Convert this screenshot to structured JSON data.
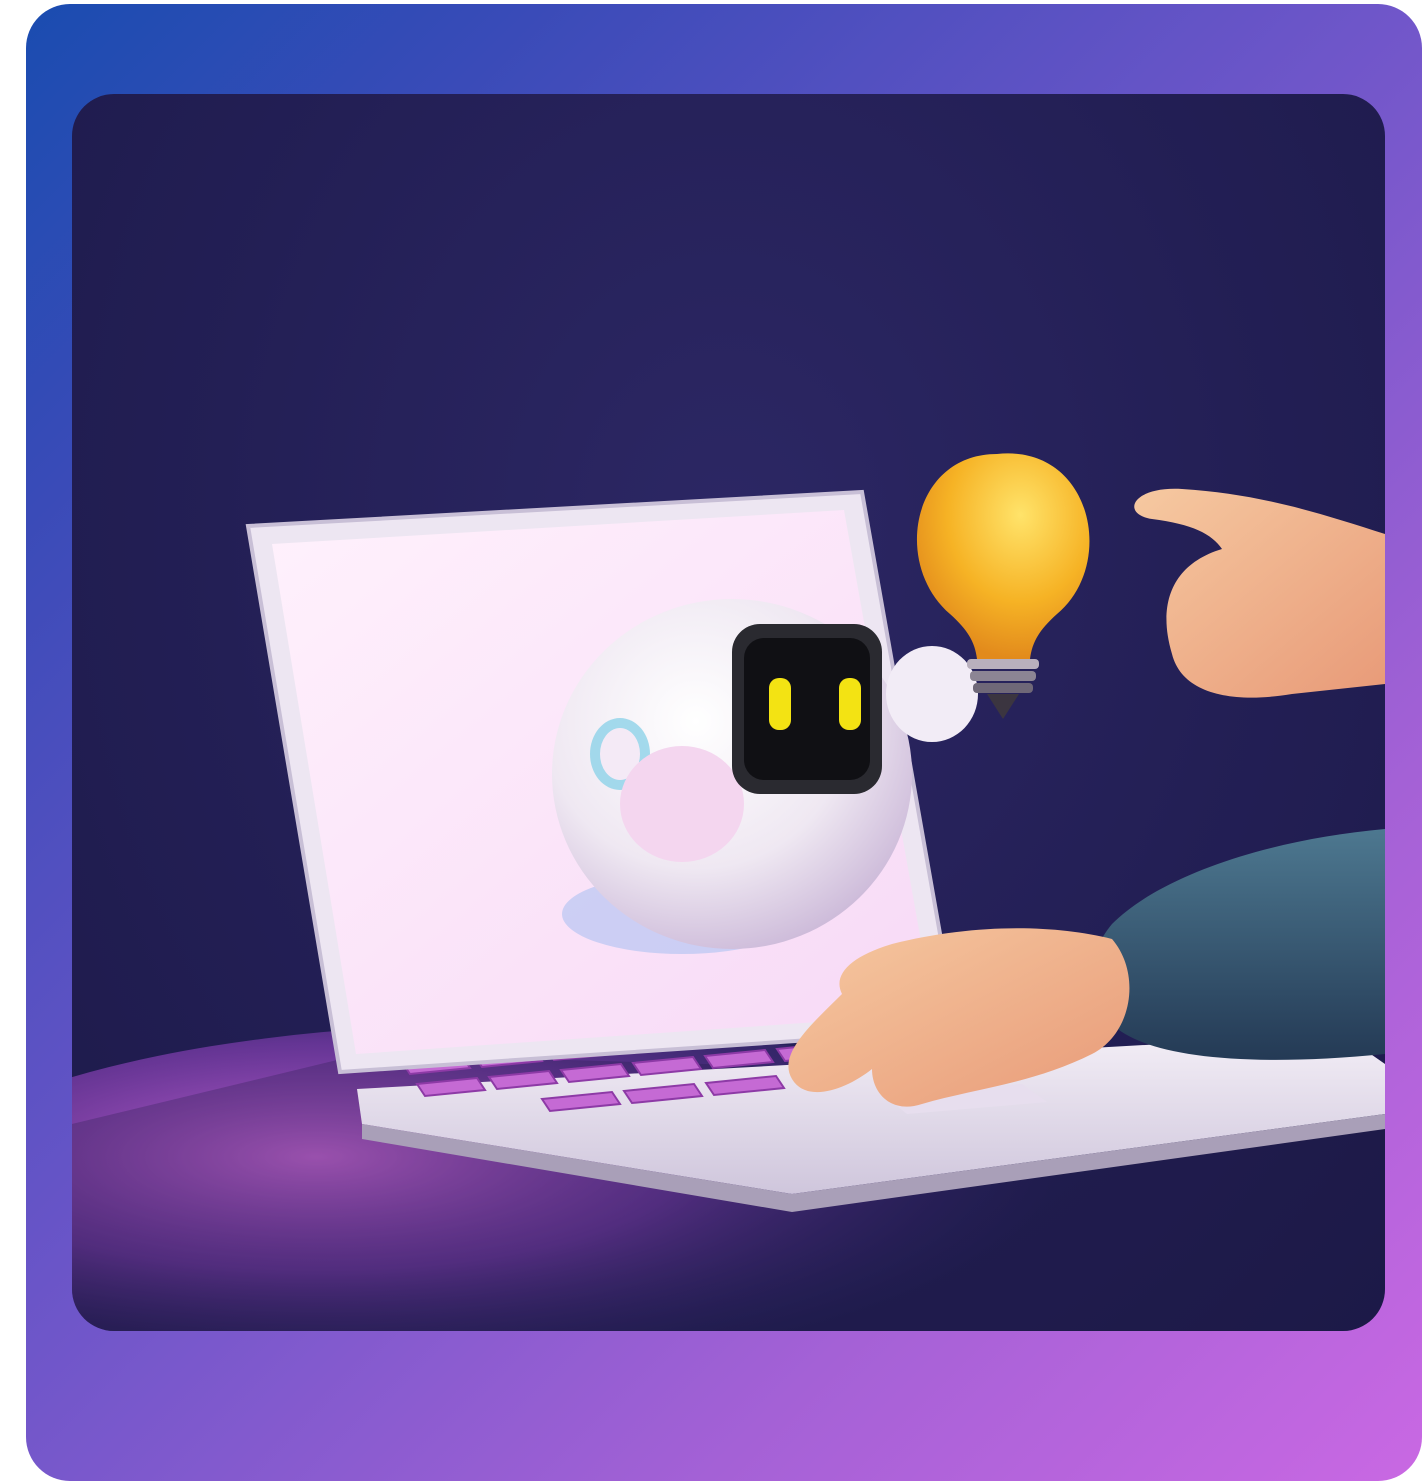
{
  "illustration": {
    "subject": "robot",
    "objects": [
      "laptop",
      "robot-head",
      "lightbulb",
      "pointing-hand",
      "typing-hand"
    ]
  },
  "colors": {
    "frame_start": "#1a4cb0",
    "frame_end": "#c968e3",
    "scene_bg": "#231f55",
    "screen_glow": "#fbe6fb",
    "keys": "#c56ad4",
    "bulb": "#f4b423",
    "robot_eyes": "#f3e313",
    "skin": "#f2b58a",
    "sleeve": "#3d5f77"
  }
}
